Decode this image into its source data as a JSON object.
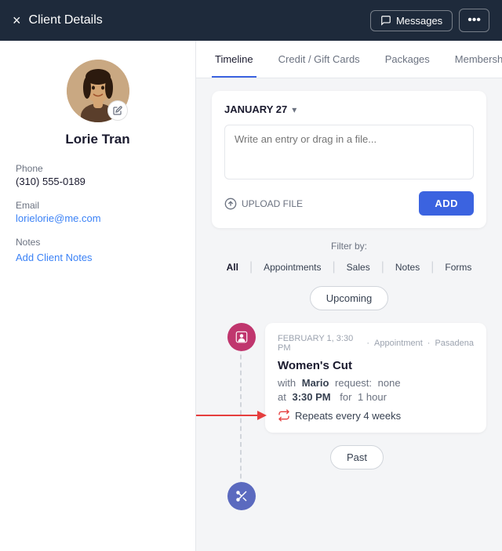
{
  "header": {
    "title": "Client Details",
    "close_icon": "×",
    "messages_label": "Messages",
    "more_icon": "···"
  },
  "sidebar": {
    "client_name": "Lorie Tran",
    "phone_label": "Phone",
    "phone_value": "(310) 555-0189",
    "email_label": "Email",
    "email_value": "lorielorie@me.com",
    "notes_label": "Notes",
    "add_notes_label": "Add Client Notes"
  },
  "tabs": [
    {
      "label": "Timeline",
      "active": true
    },
    {
      "label": "Credit / Gift Cards",
      "active": false
    },
    {
      "label": "Packages",
      "active": false
    },
    {
      "label": "Memberships",
      "active": false
    }
  ],
  "timeline": {
    "date_label": "JANUARY 27",
    "textarea_placeholder": "Write an entry or drag in a file...",
    "upload_label": "UPLOAD FILE",
    "add_label": "ADD",
    "filter_label": "Filter by:",
    "filter_options": [
      "All",
      "Appointments",
      "Sales",
      "Notes",
      "Forms"
    ],
    "active_filter": "All",
    "upcoming_label": "Upcoming",
    "past_label": "Past",
    "appointment": {
      "date": "FEBRUARY 1, 3:30 PM",
      "type": "Appointment",
      "location": "Pasadena",
      "title": "Women's Cut",
      "with_label": "with",
      "provider": "Mario",
      "request_label": "request:",
      "request_value": "none",
      "time_label": "at",
      "time_value": "3:30 PM",
      "duration_label": "for",
      "duration_value": "1 hour",
      "repeats_label": "Repeats every 4 weeks"
    }
  }
}
